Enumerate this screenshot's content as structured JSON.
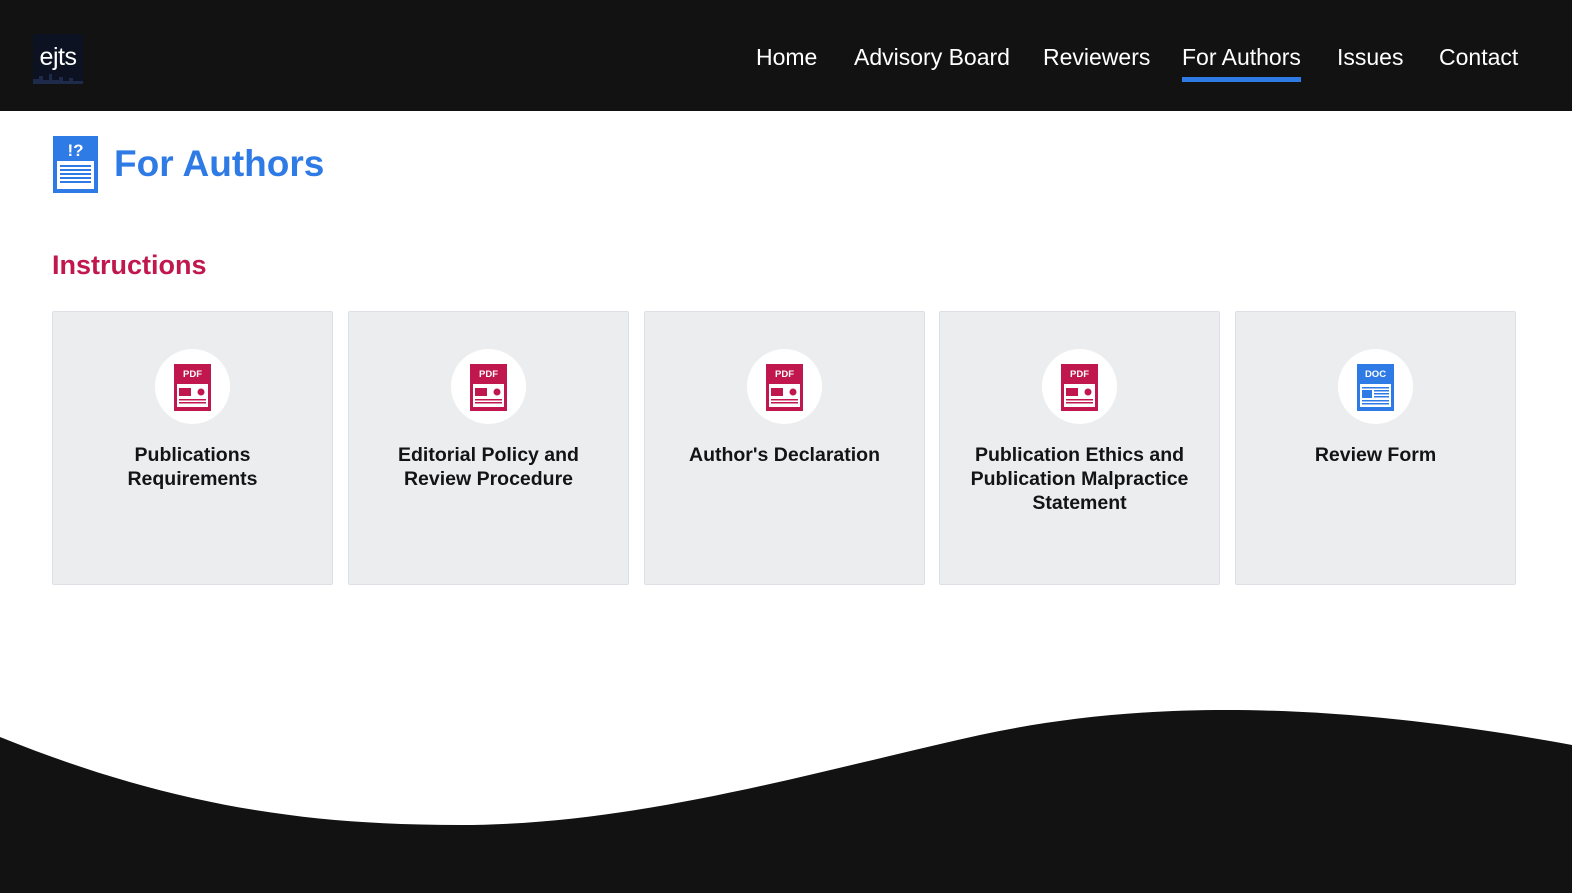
{
  "header": {
    "logo_text": "ejts",
    "nav": [
      {
        "label": "Home",
        "active": false
      },
      {
        "label": "Advisory Board",
        "active": false
      },
      {
        "label": "Reviewers",
        "active": false
      },
      {
        "label": "For Authors",
        "active": true
      },
      {
        "label": "Issues",
        "active": false
      },
      {
        "label": "Contact",
        "active": false
      }
    ]
  },
  "page": {
    "title": "For Authors",
    "title_icon": "document-question-icon",
    "section_title": "Instructions"
  },
  "cards": [
    {
      "label": "Publications Requirements",
      "file_type": "PDF",
      "icon": "pdf-file-icon"
    },
    {
      "label": "Editorial Policy and Review Procedure",
      "file_type": "PDF",
      "icon": "pdf-file-icon"
    },
    {
      "label": "Author's Declaration",
      "file_type": "PDF",
      "icon": "pdf-file-icon"
    },
    {
      "label": "Publication Ethics and Publication Malpractice Statement",
      "file_type": "PDF",
      "icon": "pdf-file-icon"
    },
    {
      "label": "Review Form",
      "file_type": "DOC",
      "icon": "doc-file-icon"
    }
  ],
  "colors": {
    "header_bg": "#121212",
    "accent_blue": "#2f7be5",
    "accent_crimson": "#c0174f",
    "card_bg": "#ebedef"
  }
}
